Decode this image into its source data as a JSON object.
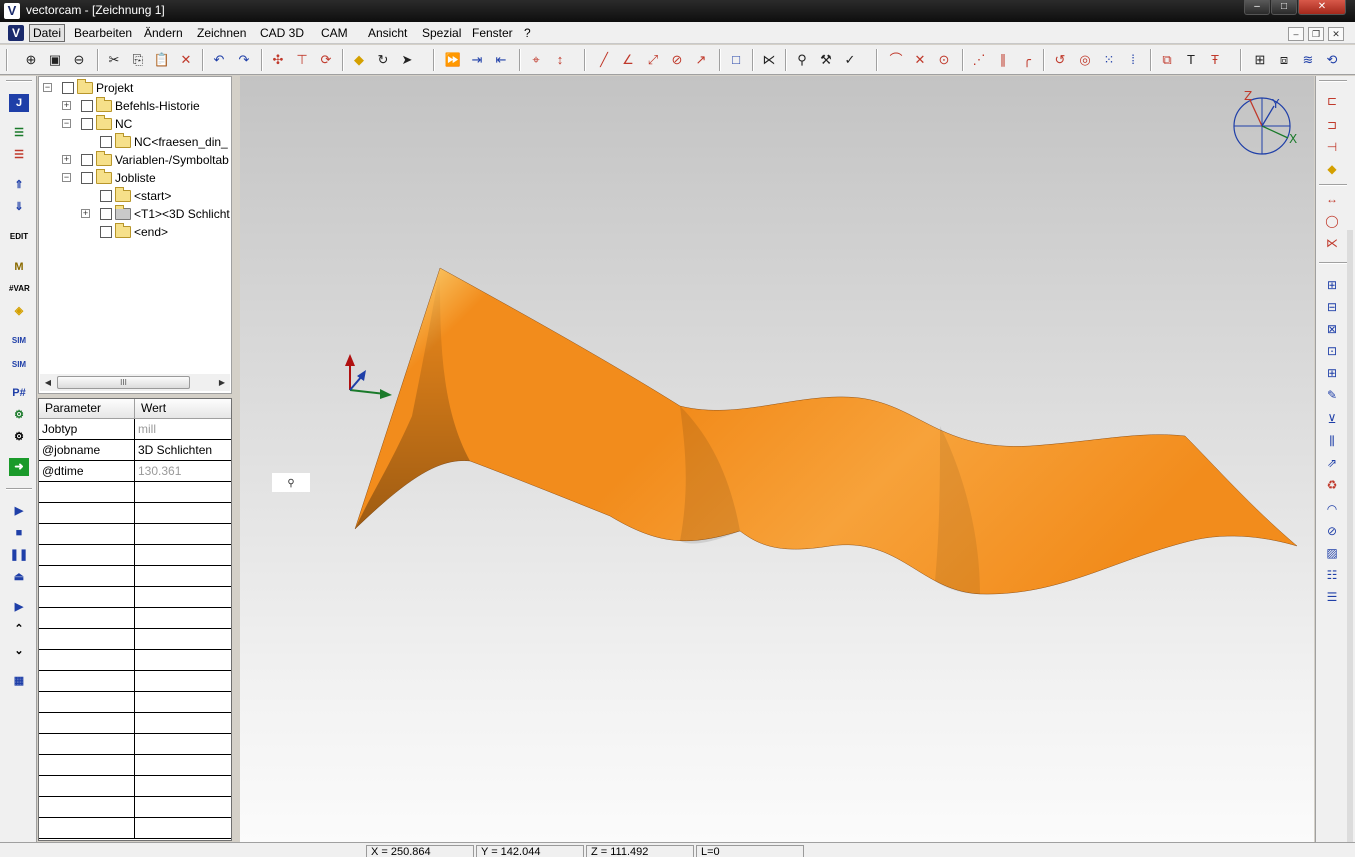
{
  "window": {
    "app_logo": "V",
    "title": "vectorcam - [Zeichnung 1]",
    "controls": {
      "minimize": "–",
      "maximize": "□",
      "close": "✕"
    }
  },
  "menu": {
    "logo": "V",
    "items": [
      "Datei",
      "Bearbeiten",
      "Ändern",
      "Zeichnen",
      "CAD 3D",
      "CAM",
      "Ansicht",
      "Spezial",
      "Fenster",
      "?"
    ],
    "mdi_controls": {
      "minimize": "–",
      "restore": "❐",
      "close": "✕"
    }
  },
  "toolbar": {
    "icons": [
      "zoom-in-icon",
      "zoom-window-icon",
      "zoom-out-icon",
      "cut-icon",
      "copy-icon",
      "paste-icon",
      "delete-icon",
      "undo-icon",
      "redo-icon",
      "xyz-point-icon",
      "move-icon",
      "xyz-rotate-icon",
      "diamond-icon",
      "rotate-3d-icon",
      "pointer-icon",
      "play-forward-icon",
      "step-in-icon",
      "step-out-icon",
      "center-icon",
      "distance-icon",
      "line-icon",
      "angle-line-icon",
      "tangent-line-icon",
      "circle-tangent-icon",
      "radius-icon",
      "rectangle-icon",
      "trim-icon",
      "tool-holder-icon",
      "tool-path-icon",
      "tool-check-icon",
      "arc-icon",
      "intersect-icon",
      "circle-center-icon",
      "xyz-offset-icon",
      "parallel-icon",
      "fillet-icon",
      "rotate-icon",
      "circle-target-icon",
      "circle-dots-icon",
      "grid-dots-icon",
      "copy-object-icon",
      "text-icon",
      "text-outline-icon",
      "open-book-icon",
      "pages-icon",
      "layers-icon",
      "rotate-view-icon"
    ]
  },
  "tree": {
    "items": [
      {
        "label": "Projekt"
      },
      {
        "label": "Befehls-Historie"
      },
      {
        "label": "NC"
      },
      {
        "label": "NC<fraesen_din_"
      },
      {
        "label": "Variablen-/Symboltab"
      },
      {
        "label": "Jobliste"
      },
      {
        "label": "<start>"
      },
      {
        "label": "<T1><3D Schlicht"
      },
      {
        "label": "<end>"
      }
    ],
    "scroll_grip": "III"
  },
  "params": {
    "header": {
      "name": "Parameter",
      "value": "Wert"
    },
    "rows": [
      {
        "name": "Jobtyp",
        "value": "mill"
      },
      {
        "name": "@jobname",
        "value": "3D Schlichten"
      },
      {
        "name": "@dtime",
        "value": "130.361"
      }
    ]
  },
  "viewport": {
    "surface_color": "#f28c1c",
    "highlight_color": "#fff6a0",
    "shadow_color": "#7a3a00",
    "axis_labels": {
      "x": "X",
      "y": "Y",
      "z": "Z"
    }
  },
  "status": {
    "x": "X = 250.864",
    "y": "Y = 142.044",
    "z": "Z = 111.492",
    "l": "L=0"
  }
}
